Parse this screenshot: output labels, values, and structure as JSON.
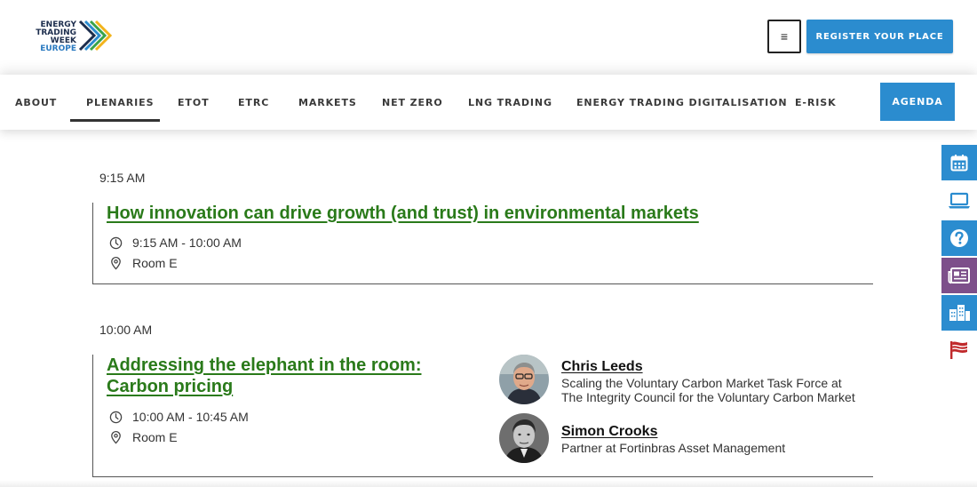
{
  "brand": {
    "logo_lines": [
      "ENERGY",
      "TRADING WEEK",
      "EUROPE"
    ],
    "colors": {
      "blue": "#2b8ccf",
      "green": "#2a7a1a",
      "purple": "#7d4f8a",
      "red": "#c0292b"
    }
  },
  "header": {
    "menu_icon": "hamburger-icon",
    "menu_glyph": "≡",
    "register_label": "REGISTER YOUR PLACE"
  },
  "nav": {
    "items": [
      {
        "label": "ABOUT"
      },
      {
        "label": "PLENARIES",
        "active": true
      },
      {
        "label": "ETOT"
      },
      {
        "label": "ETRC"
      },
      {
        "label": "MARKETS"
      },
      {
        "label": "NET ZERO"
      },
      {
        "label": "LNG TRADING"
      },
      {
        "label": "ENERGY TRADING DIGITALISATION"
      },
      {
        "label": "E-RISK"
      }
    ],
    "agenda_label": "AGENDA"
  },
  "side_tabs": [
    {
      "icon": "calendar-icon"
    },
    {
      "icon": "laptop-icon"
    },
    {
      "icon": "question-icon"
    },
    {
      "icon": "newspaper-icon"
    },
    {
      "icon": "buildings-icon"
    },
    {
      "icon": "flag-icon"
    }
  ],
  "sessions": [
    {
      "time": "9:15 AM",
      "title": "How innovation can drive growth (and trust) in environmental markets",
      "time_range": "9:15 AM - 10:00 AM",
      "room": "Room E"
    },
    {
      "time": "10:00 AM",
      "title_lines": [
        "Addressing the elephant in the room:",
        "Carbon pricing"
      ],
      "time_range": "10:00 AM - 10:45 AM",
      "room": "Room E",
      "speakers": [
        {
          "name": "Chris Leeds",
          "role_lines": [
            "Scaling the Voluntary Carbon Market Task Force at",
            "The Integrity Council for the Voluntary Carbon Market"
          ]
        },
        {
          "name": "Simon Crooks",
          "role_lines": [
            "Partner at Fortinbras Asset Management"
          ]
        }
      ]
    }
  ]
}
